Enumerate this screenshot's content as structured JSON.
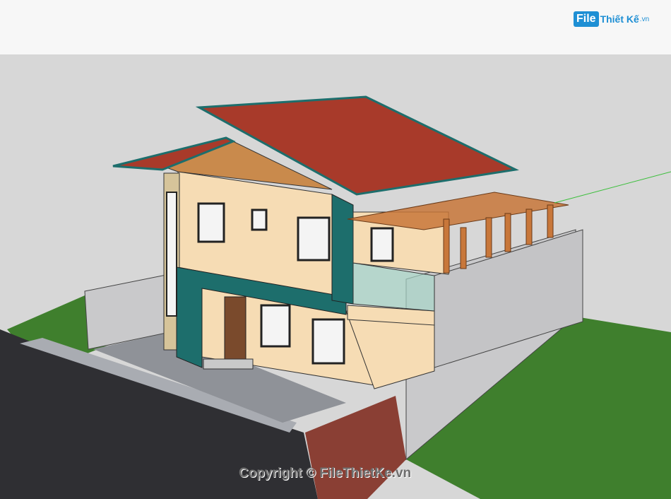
{
  "logo": {
    "file_label": "File",
    "rest_label": "Thiết Kế",
    "suffix_label": ".vn"
  },
  "watermark": {
    "text": "Copyright © FileThietKe.vn"
  },
  "colors": {
    "background": "#d7d7d7",
    "roof": "#a83a2a",
    "roof_trim": "#1d6e6c",
    "siding": "#f6dcb4",
    "grass": "#3f7f2d",
    "road": "#2f2f33",
    "wall_gray": "#c9c9cb",
    "pergola": "#c8773a"
  }
}
